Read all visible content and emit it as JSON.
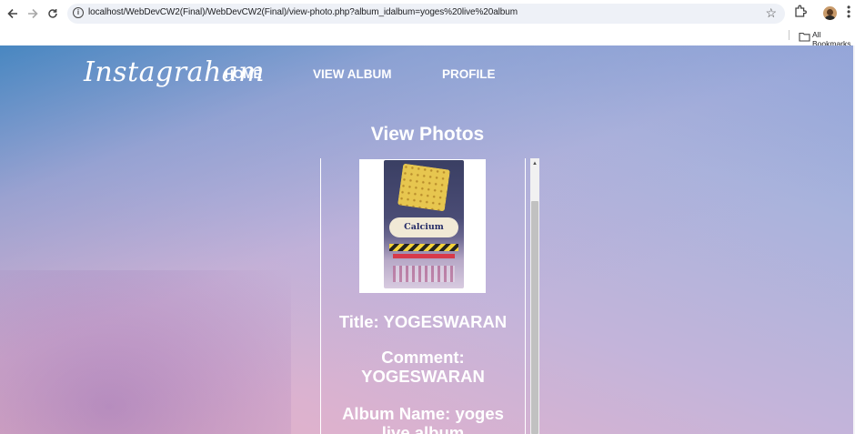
{
  "browser": {
    "url": "localhost/WebDevCW2(Final)/WebDevCW2(Final)/view-photo.php?album_idalbum=yoges%20live%20album",
    "bookmarks_label": "All Bookmarks",
    "icons": {
      "back": "back-arrow-icon",
      "forward": "forward-arrow-icon",
      "reload": "reload-icon",
      "site_info": "site-info-icon",
      "bookmark": "star-icon",
      "extensions": "puzzle-icon",
      "profile": "avatar",
      "menu": "kebab-menu-icon",
      "folder": "folder-icon"
    }
  },
  "site": {
    "logo": "Instagraham",
    "nav": {
      "home": "HOME",
      "view_album": "VIEW ALBUM",
      "profile": "PROFILE"
    }
  },
  "main": {
    "heading": "View Photos",
    "photo": {
      "image_brand_text": "Calcium",
      "title": "Title: YOGESWARAN",
      "comment": "Comment: YOGESWARAN",
      "album_name": "Album Name: yoges live album"
    }
  }
}
